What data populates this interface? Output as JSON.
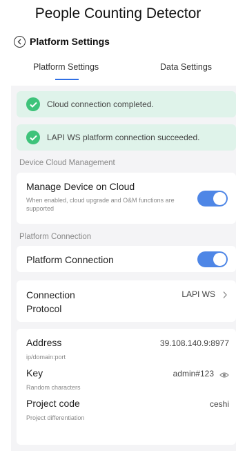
{
  "app_title": "People Counting Detector",
  "nav": {
    "title": "Platform Settings"
  },
  "tabs": [
    {
      "label": "Platform Settings",
      "active": true
    },
    {
      "label": "Data Settings",
      "active": false
    }
  ],
  "banners": [
    {
      "text": "Cloud connection completed."
    },
    {
      "text": "LAPI WS platform connection succeeded."
    }
  ],
  "device_cloud": {
    "section_label": "Device Cloud Management",
    "title": "Manage Device on Cloud",
    "description": "When enabled, cloud upgrade and O&M functions are supported",
    "enabled": true
  },
  "platform_connection": {
    "section_label": "Platform Connection",
    "title": "Platform Connection",
    "enabled": true
  },
  "protocol": {
    "title": "Connection Protocol",
    "value": "LAPI WS"
  },
  "fields": {
    "address": {
      "label": "Address",
      "hint": "ip/domain:port",
      "value": "39.108.140.9:8977"
    },
    "key": {
      "label": "Key",
      "hint": "Random characters",
      "value": "admin#123"
    },
    "project_code": {
      "label": "Project code",
      "hint": "Project differentiation",
      "value": "ceshi"
    }
  },
  "colors": {
    "accent": "#4e86e6",
    "success": "#3ec37a",
    "banner_bg": "#dff3ea",
    "panel_bg": "#f4f4f6"
  },
  "icons": [
    "back-arrow-icon",
    "check-circle-icon",
    "chevron-right-icon",
    "eye-icon"
  ]
}
